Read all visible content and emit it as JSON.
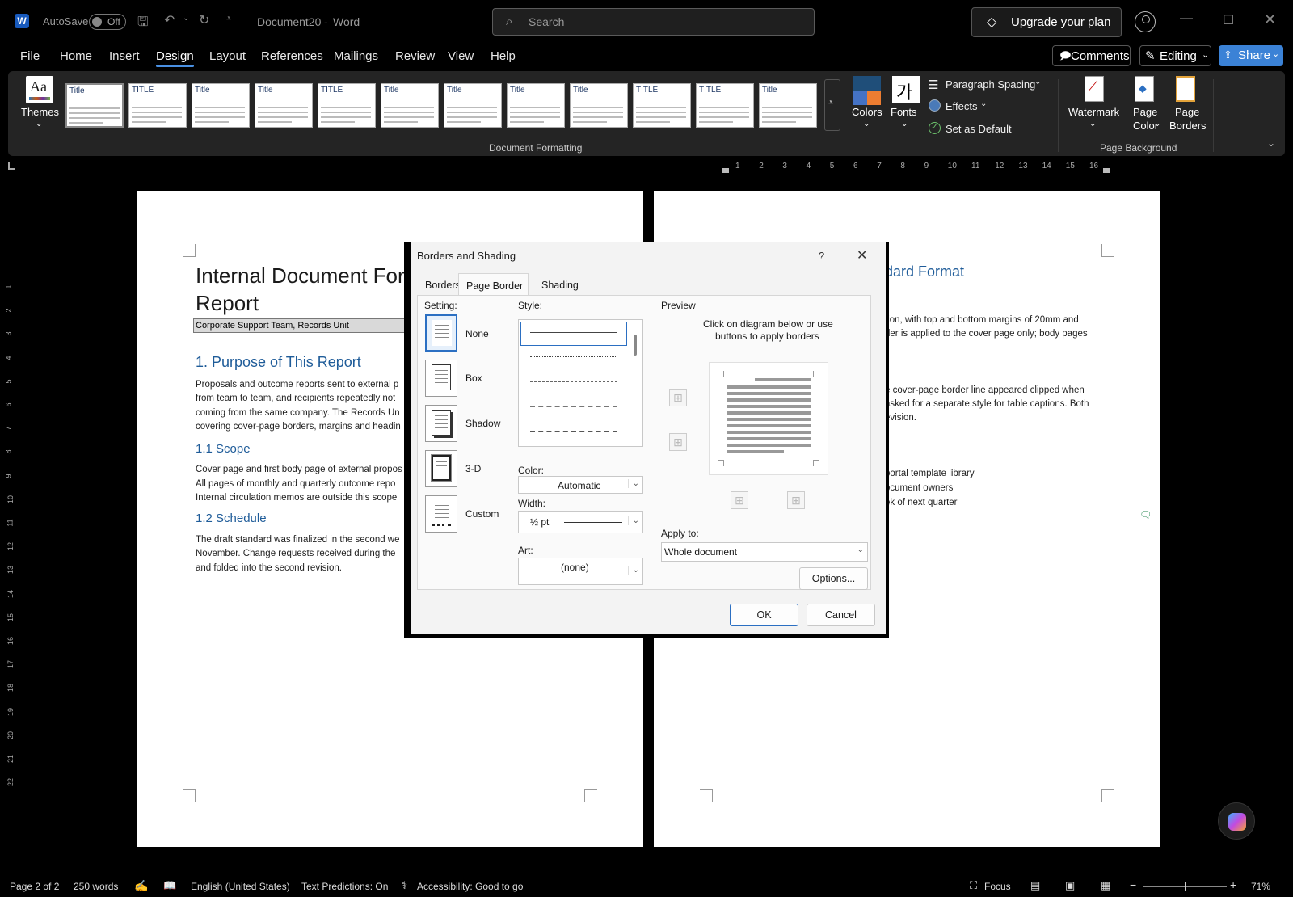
{
  "titlebar": {
    "autosave_label": "AutoSave",
    "autosave_state": "Off",
    "doc_name": "Document20",
    "separator": "-",
    "app_name": "Word",
    "search_placeholder": "Search",
    "upgrade_label": "Upgrade your plan"
  },
  "menu": {
    "items": [
      "File",
      "Home",
      "Insert",
      "Design",
      "Layout",
      "References",
      "Mailings",
      "Review",
      "View",
      "Help"
    ],
    "active": "Design",
    "comments_label": "Comments",
    "editing_label": "Editing",
    "share_label": "Share"
  },
  "ribbon": {
    "themes_label": "Themes",
    "gallery_titles": [
      "Title",
      "TITLE",
      "Title",
      "Title",
      "TITLE",
      "Title",
      "Title",
      "Title",
      "Title",
      "TITLE",
      "TITLE",
      "Title"
    ],
    "colors_label": "Colors",
    "fonts_label": "Fonts",
    "fonts_glyph": "가",
    "paragraph_spacing_label": "Paragraph Spacing",
    "effects_label": "Effects",
    "set_default_label": "Set as Default",
    "doc_formatting_group": "Document Formatting",
    "watermark_label": "Watermark",
    "page_color_label": [
      "Page",
      "Color"
    ],
    "page_borders_label": [
      "Page",
      "Borders"
    ],
    "page_background_group": "Page Background"
  },
  "ruler": {
    "h_numbers": [
      "1",
      "2",
      "3",
      "4",
      "5",
      "6",
      "7",
      "8",
      "9",
      "10",
      "11",
      "12",
      "13",
      "14",
      "15",
      "16"
    ],
    "v_numbers": [
      "1",
      "2",
      "3",
      "4",
      "5",
      "6",
      "7",
      "8",
      "9",
      "10",
      "11",
      "12",
      "13",
      "14",
      "15",
      "16",
      "17",
      "18",
      "19",
      "20",
      "21",
      "22"
    ]
  },
  "page1": {
    "title_line1": "Internal Document Form",
    "title_line2": "Report",
    "subtitle": "Corporate Support Team, Records Unit",
    "h1": "1. Purpose of This Report",
    "p1": [
      "Proposals and outcome reports sent to external p",
      "from team to team, and recipients repeatedly not",
      "coming from the same company. The Records Un",
      "covering cover-page borders, margins and headin"
    ],
    "h2_scope": "1.1 Scope",
    "p2": [
      "Cover page and first body page of external propos",
      "All pages of monthly and quarterly outcome repo",
      "Internal circulation memos are outside this scope"
    ],
    "h2_schedule": "1.2 Schedule",
    "p3": [
      "The draft standard was finalized in the second we",
      "November. Change requests received during the",
      "and folded into the second revision."
    ]
  },
  "page2": {
    "heading": "dard Format",
    "p1": [
      "tion, with top and bottom margins of 20mm and",
      "der is applied to the cover page only; body pages"
    ],
    "p2": [
      "e cover-page border line appeared clipped when",
      "asked for a separate style for table captions. Both",
      "evision."
    ],
    "list": [
      "portal template library",
      "ocument owners",
      "ek of next quarter"
    ]
  },
  "dialog": {
    "title": "Borders and Shading",
    "help": "?",
    "tabs": [
      "Borders",
      "Page Border",
      "Shading"
    ],
    "active_tab": "Page Border",
    "setting_label": "Setting:",
    "settings": [
      "None",
      "Box",
      "Shadow",
      "3-D",
      "Custom"
    ],
    "selected_setting": "None",
    "style_label": "Style:",
    "color_label": "Color:",
    "color_value": "Automatic",
    "width_label": "Width:",
    "width_value": "½ pt",
    "art_label": "Art:",
    "art_value": "(none)",
    "preview_label": "Preview",
    "preview_hint": [
      "Click on diagram below or use",
      "buttons to apply borders"
    ],
    "apply_to_label": "Apply to:",
    "apply_to_value": "Whole document",
    "options_label": "Options...",
    "ok_label": "OK",
    "cancel_label": "Cancel"
  },
  "status": {
    "page": "Page 2 of 2",
    "words": "250 words",
    "language": "English (United States)",
    "text_predictions": "Text Predictions: On",
    "accessibility": "Accessibility: Good to go",
    "focus": "Focus",
    "zoom": "71%"
  },
  "colors": {
    "accent": "#3b82d6",
    "heading_blue": "#1f5c99",
    "word_blue": "#185abd"
  }
}
